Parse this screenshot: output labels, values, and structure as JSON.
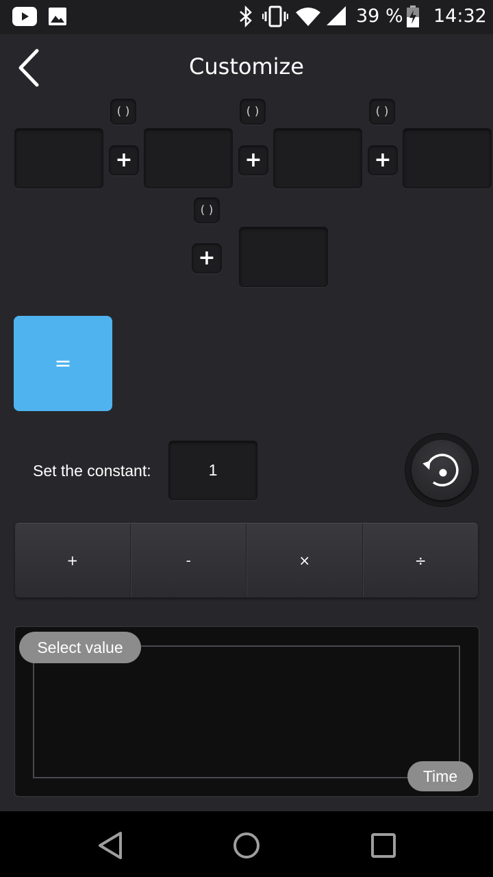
{
  "status_bar": {
    "battery": "39 %",
    "time": "14:32",
    "icons": [
      "youtube-icon",
      "image-icon",
      "bluetooth-icon",
      "vibrate-icon",
      "wifi-icon",
      "signal-icon",
      "battery-icon"
    ]
  },
  "app_bar": {
    "title": "Customize",
    "back_icon": "chevron-left-icon"
  },
  "formula": {
    "paren_label": "(   )",
    "plus_label": "+"
  },
  "equals_label": "=",
  "constant": {
    "label": "Set the constant:",
    "value": "1"
  },
  "operators": [
    "+",
    "-",
    "×",
    "÷"
  ],
  "graph": {
    "y_label": "Select value",
    "x_label": "Time"
  },
  "colors": {
    "accent": "#4fb3f0",
    "background": "#27272b"
  }
}
